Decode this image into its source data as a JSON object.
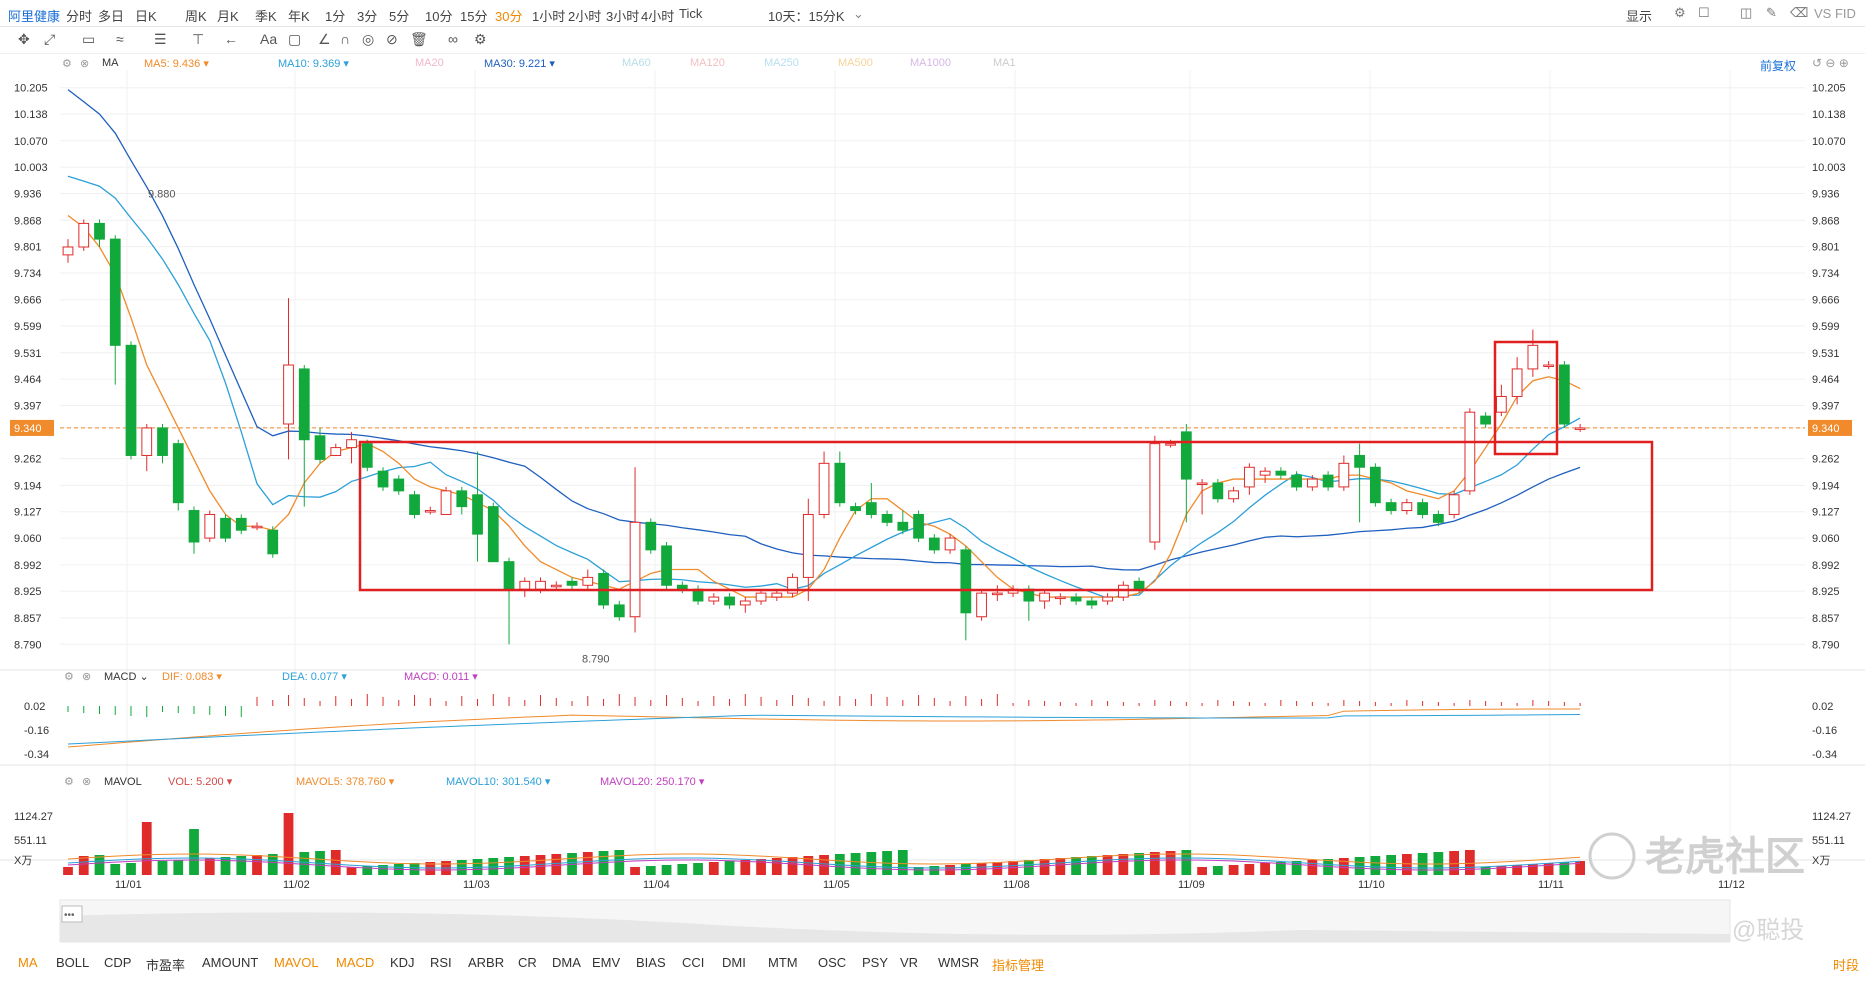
{
  "header": {
    "symbol": "阿里健康",
    "timeframes": [
      "分时",
      "多日",
      "日K",
      "周K",
      "月K",
      "季K",
      "年K",
      "1分",
      "3分",
      "5分",
      "10分",
      "15分",
      "30分",
      "1小时",
      "2小时",
      "3小时",
      "4小时",
      "Tick"
    ],
    "active_timeframe": "30分",
    "range_selector": "10天：15分K",
    "display_label": "显示",
    "vs_label": "VS FID"
  },
  "ma_panel": {
    "name": "MA",
    "legend": [
      {
        "label": "MA5: 9.436",
        "color": "#f08a2b",
        "on": true
      },
      {
        "label": "MA10: 9.369",
        "color": "#2ca0d8",
        "on": true
      },
      {
        "label": "MA20",
        "color": "#f2b8c8",
        "on": false
      },
      {
        "label": "MA30: 9.221",
        "color": "#1f5fbf",
        "on": true
      },
      {
        "label": "MA60",
        "color": "#b6dfe8",
        "on": false
      },
      {
        "label": "MA120",
        "color": "#f3c0c0",
        "on": false
      },
      {
        "label": "MA250",
        "color": "#b7e0f0",
        "on": false
      },
      {
        "label": "MA500",
        "color": "#f5d49a",
        "on": false
      },
      {
        "label": "MA1000",
        "color": "#d5b8e6",
        "on": false
      },
      {
        "label": "MA1",
        "color": "#cccccc",
        "on": false
      }
    ],
    "adjust_label": "前复权",
    "price_ticks": [
      "10.205",
      "10.138",
      "10.070",
      "10.003",
      "9.936",
      "9.868",
      "9.801",
      "9.734",
      "9.666",
      "9.599",
      "9.531",
      "9.464",
      "9.397",
      "9.340",
      "9.262",
      "9.194",
      "9.127",
      "9.060",
      "8.992",
      "8.925",
      "8.857",
      "8.790"
    ],
    "current_price": "9.340",
    "high_annotation": "9.880",
    "low_annotation": "8.790"
  },
  "macd_panel": {
    "name": "MACD",
    "legend": [
      {
        "label": "DIF: 0.083",
        "color": "#f08a2b"
      },
      {
        "label": "DEA: 0.077",
        "color": "#2ca0d8"
      },
      {
        "label": "MACD: 0.011",
        "color": "#c040c0"
      }
    ],
    "ticks": [
      "0.02",
      "-0.16",
      "-0.34"
    ]
  },
  "mavol_panel": {
    "name": "MAVOL",
    "legend": [
      {
        "label": "VOL: 5.200",
        "color": "#d64a4a"
      },
      {
        "label": "MAVOL5: 378.760",
        "color": "#f08a2b"
      },
      {
        "label": "MAVOL10: 301.540",
        "color": "#2ca0d8"
      },
      {
        "label": "MAVOL20: 250.170",
        "color": "#c040c0"
      }
    ],
    "ticks": [
      "1124.27",
      "551.11",
      "X万"
    ]
  },
  "x_axis_dates": [
    "11/01",
    "11/02",
    "11/03",
    "11/04",
    "11/05",
    "11/08",
    "11/09",
    "11/10",
    "11/11",
    "11/12"
  ],
  "bottom_tabs": [
    "MA",
    "BOLL",
    "CDP",
    "市盈率",
    "AMOUNT",
    "MAVOL",
    "MACD",
    "KDJ",
    "RSI",
    "ARBR",
    "CR",
    "DMA",
    "EMV",
    "BIAS",
    "CCI",
    "DMI",
    "MTM",
    "OSC",
    "PSY",
    "VR",
    "WMSR",
    "指标管理"
  ],
  "active_tabs": [
    "MA",
    "MAVOL",
    "MACD",
    "指标管理"
  ],
  "bottom_right": "时段",
  "watermark": {
    "brand": "老虎社区",
    "handle": "@聪投"
  },
  "colors": {
    "up": "#e02b2b",
    "down": "#12a93c",
    "accent": "#f08a00",
    "box": "#e02020"
  },
  "chart_data": {
    "type": "candlestick",
    "y_range": [
      8.75,
      10.25
    ],
    "candles": [
      [
        9.78,
        9.8,
        9.76,
        9.82
      ],
      [
        9.8,
        9.86,
        9.79,
        9.87
      ],
      [
        9.86,
        9.82,
        9.8,
        9.87
      ],
      [
        9.82,
        9.55,
        9.45,
        9.83
      ],
      [
        9.55,
        9.27,
        9.26,
        9.56
      ],
      [
        9.27,
        9.34,
        9.23,
        9.35
      ],
      [
        9.34,
        9.27,
        9.25,
        9.35
      ],
      [
        9.3,
        9.15,
        9.13,
        9.31
      ],
      [
        9.13,
        9.05,
        9.02,
        9.14
      ],
      [
        9.06,
        9.12,
        9.05,
        9.13
      ],
      [
        9.11,
        9.06,
        9.05,
        9.12
      ],
      [
        9.11,
        9.08,
        9.07,
        9.12
      ],
      [
        9.09,
        9.09,
        9.08,
        9.1
      ],
      [
        9.08,
        9.02,
        9.01,
        9.09
      ],
      [
        9.35,
        9.5,
        9.26,
        9.67
      ],
      [
        9.49,
        9.31,
        9.14,
        9.5
      ],
      [
        9.32,
        9.26,
        9.25,
        9.34
      ],
      [
        9.27,
        9.29,
        9.27,
        9.3
      ],
      [
        9.29,
        9.31,
        9.25,
        9.33
      ],
      [
        9.3,
        9.24,
        9.23,
        9.31
      ],
      [
        9.23,
        9.19,
        9.18,
        9.24
      ],
      [
        9.21,
        9.18,
        9.17,
        9.22
      ],
      [
        9.17,
        9.12,
        9.11,
        9.18
      ],
      [
        9.13,
        9.13,
        9.12,
        9.14
      ],
      [
        9.12,
        9.18,
        9.12,
        9.19
      ],
      [
        9.18,
        9.14,
        9.12,
        9.19
      ],
      [
        9.17,
        9.07,
        9.0,
        9.28
      ],
      [
        9.14,
        9.0,
        9.0,
        9.15
      ],
      [
        9.0,
        8.93,
        8.79,
        9.01
      ],
      [
        8.93,
        8.95,
        8.91,
        8.96
      ],
      [
        8.93,
        8.95,
        8.92,
        8.96
      ],
      [
        8.94,
        8.94,
        8.93,
        8.95
      ],
      [
        8.95,
        8.94,
        8.93,
        8.96
      ],
      [
        8.94,
        8.96,
        8.93,
        8.98
      ],
      [
        8.97,
        8.89,
        8.88,
        8.98
      ],
      [
        8.89,
        8.86,
        8.85,
        8.9
      ],
      [
        8.86,
        9.1,
        8.82,
        9.24
      ],
      [
        9.1,
        9.03,
        9.02,
        9.11
      ],
      [
        9.04,
        8.94,
        8.93,
        9.05
      ],
      [
        8.94,
        8.93,
        8.92,
        8.95
      ],
      [
        8.93,
        8.9,
        8.89,
        8.94
      ],
      [
        8.9,
        8.91,
        8.89,
        8.92
      ],
      [
        8.91,
        8.89,
        8.88,
        8.92
      ],
      [
        8.89,
        8.9,
        8.87,
        8.91
      ],
      [
        8.9,
        8.92,
        8.89,
        8.93
      ],
      [
        8.91,
        8.92,
        8.9,
        8.93
      ],
      [
        8.92,
        8.96,
        8.91,
        8.97
      ],
      [
        8.96,
        9.12,
        8.9,
        9.16
      ],
      [
        9.12,
        9.25,
        9.11,
        9.28
      ],
      [
        9.25,
        9.15,
        9.14,
        9.28
      ],
      [
        9.14,
        9.13,
        9.12,
        9.15
      ],
      [
        9.15,
        9.12,
        9.11,
        9.2
      ],
      [
        9.12,
        9.1,
        9.09,
        9.13
      ],
      [
        9.1,
        9.08,
        9.07,
        9.13
      ],
      [
        9.12,
        9.06,
        9.05,
        9.13
      ],
      [
        9.06,
        9.03,
        9.02,
        9.07
      ],
      [
        9.03,
        9.06,
        9.02,
        9.07
      ],
      [
        9.03,
        8.87,
        8.8,
        9.04
      ],
      [
        8.86,
        8.92,
        8.85,
        8.93
      ],
      [
        8.92,
        8.92,
        8.9,
        8.94
      ],
      [
        8.92,
        8.93,
        8.91,
        8.94
      ],
      [
        8.93,
        8.9,
        8.85,
        8.94
      ],
      [
        8.9,
        8.92,
        8.88,
        8.93
      ],
      [
        8.91,
        8.91,
        8.89,
        8.92
      ],
      [
        8.91,
        8.9,
        8.89,
        8.92
      ],
      [
        8.9,
        8.89,
        8.88,
        8.91
      ],
      [
        8.9,
        8.91,
        8.89,
        8.92
      ],
      [
        8.91,
        8.94,
        8.9,
        8.95
      ],
      [
        8.95,
        8.93,
        8.92,
        8.96
      ],
      [
        9.05,
        9.3,
        9.03,
        9.32
      ],
      [
        9.3,
        9.3,
        9.29,
        9.31
      ],
      [
        9.33,
        9.21,
        9.1,
        9.35
      ],
      [
        9.2,
        9.2,
        9.12,
        9.21
      ],
      [
        9.2,
        9.16,
        9.15,
        9.21
      ],
      [
        9.16,
        9.18,
        9.15,
        9.19
      ],
      [
        9.19,
        9.24,
        9.17,
        9.25
      ],
      [
        9.22,
        9.23,
        9.2,
        9.24
      ],
      [
        9.23,
        9.22,
        9.21,
        9.24
      ],
      [
        9.22,
        9.19,
        9.18,
        9.23
      ],
      [
        9.19,
        9.21,
        9.18,
        9.22
      ],
      [
        9.22,
        9.19,
        9.18,
        9.23
      ],
      [
        9.19,
        9.25,
        9.18,
        9.27
      ],
      [
        9.27,
        9.24,
        9.1,
        9.3
      ],
      [
        9.24,
        9.15,
        9.14,
        9.25
      ],
      [
        9.15,
        9.13,
        9.12,
        9.16
      ],
      [
        9.13,
        9.15,
        9.12,
        9.16
      ],
      [
        9.15,
        9.12,
        9.11,
        9.16
      ],
      [
        9.12,
        9.1,
        9.09,
        9.13
      ],
      [
        9.12,
        9.17,
        9.11,
        9.18
      ],
      [
        9.18,
        9.38,
        9.17,
        9.39
      ],
      [
        9.37,
        9.35,
        9.34,
        9.38
      ],
      [
        9.38,
        9.42,
        9.37,
        9.45
      ],
      [
        9.42,
        9.49,
        9.4,
        9.52
      ],
      [
        9.49,
        9.55,
        9.47,
        9.59
      ],
      [
        9.5,
        9.5,
        9.49,
        9.51
      ],
      [
        9.5,
        9.35,
        9.34,
        9.51
      ],
      [
        9.34,
        9.34,
        9.33,
        9.35
      ]
    ],
    "ma5": [
      9.88,
      9.85,
      9.8,
      9.73,
      9.62,
      9.5,
      9.42,
      9.34,
      9.26,
      9.18,
      9.12,
      9.09,
      9.09,
      9.08,
      9.12,
      9.2,
      9.25,
      9.28,
      9.29,
      9.3,
      9.28,
      9.25,
      9.21,
      9.19,
      9.18,
      9.17,
      9.15,
      9.13,
      9.09,
      9.04,
      9.0,
      8.98,
      8.96,
      8.95,
      8.94,
      8.93,
      8.95,
      8.97,
      8.98,
      8.98,
      8.98,
      8.95,
      8.93,
      8.91,
      8.91,
      8.91,
      8.91,
      8.93,
      8.98,
      9.06,
      9.13,
      9.16,
      9.16,
      9.13,
      9.1,
      9.09,
      9.07,
      9.04,
      9.0,
      8.96,
      8.93,
      8.92,
      8.91,
      8.91,
      8.91,
      8.91,
      8.91,
      8.91,
      8.92,
      8.95,
      9.02,
      9.12,
      9.18,
      9.2,
      9.21,
      9.21,
      9.21,
      9.21,
      9.21,
      9.21,
      9.21,
      9.22,
      9.22,
      9.21,
      9.2,
      9.18,
      9.17,
      9.16,
      9.18,
      9.23,
      9.29,
      9.35,
      9.42,
      9.46,
      9.47,
      9.46,
      9.44
    ]
  }
}
